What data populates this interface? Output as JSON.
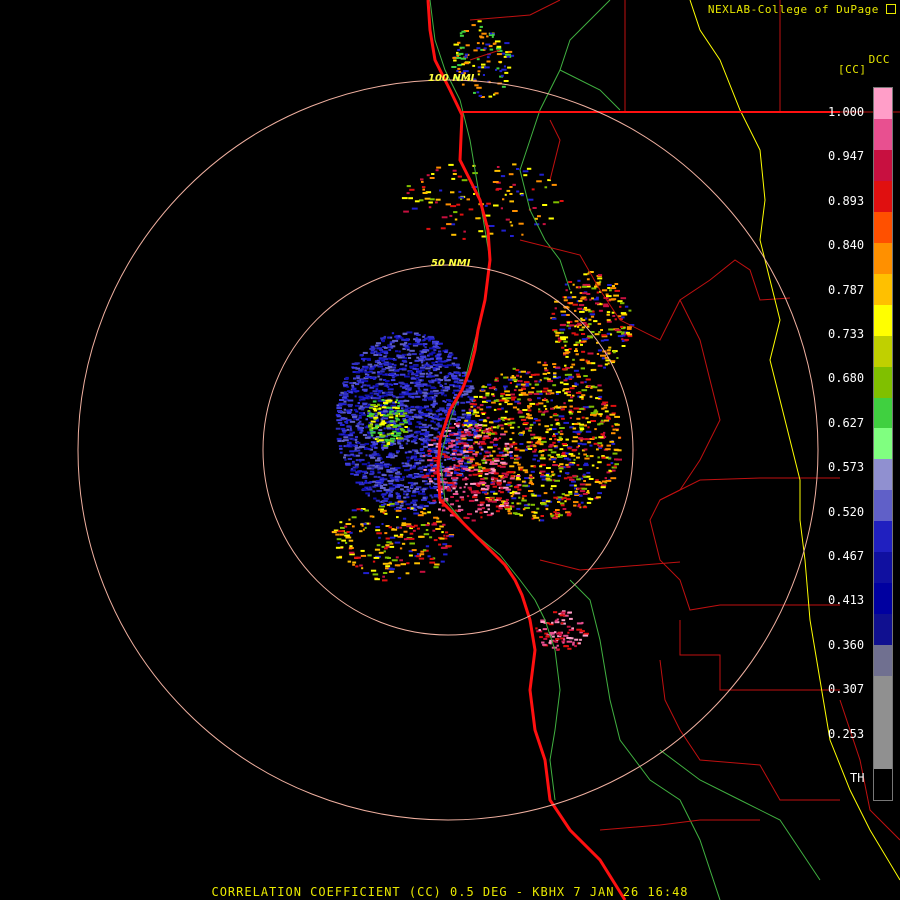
{
  "header": {
    "credit": "NEXLAB-College of DuPage",
    "credit_icon": "external-link-icon",
    "product_code": "DCC",
    "units": "[CC]"
  },
  "footer": {
    "caption": "CORRELATION COEFFICIENT (CC) 0.5 DEG - KBHX 7 JAN 26 16:48"
  },
  "range_rings": [
    {
      "label": "100 NMI"
    },
    {
      "label": "50 NMI"
    }
  ],
  "legend": {
    "ticks": [
      "1.000",
      "0.947",
      "0.893",
      "0.840",
      "0.787",
      "0.733",
      "0.680",
      "0.627",
      "0.573",
      "0.520",
      "0.467",
      "0.413",
      "0.360",
      "0.307",
      "0.253",
      "TH"
    ],
    "colors": [
      "#ff9ec8",
      "#e85090",
      "#c81040",
      "#e01010",
      "#ff5000",
      "#ff9000",
      "#ffc000",
      "#ffff00",
      "#c0d000",
      "#80c000",
      "#40d040",
      "#80ff80",
      "#9090d0",
      "#6060c8",
      "#2020c0",
      "#1010a0",
      "#0000a0",
      "#101090",
      "#707090",
      "#909090",
      "#909090",
      "#909090",
      "#000000"
    ]
  },
  "map_colors": {
    "highway": "#ff1010",
    "county_lines": "#c01010",
    "state_line": "#ffff00",
    "coast": "#40b040",
    "rings": "#f0b0a0"
  }
}
